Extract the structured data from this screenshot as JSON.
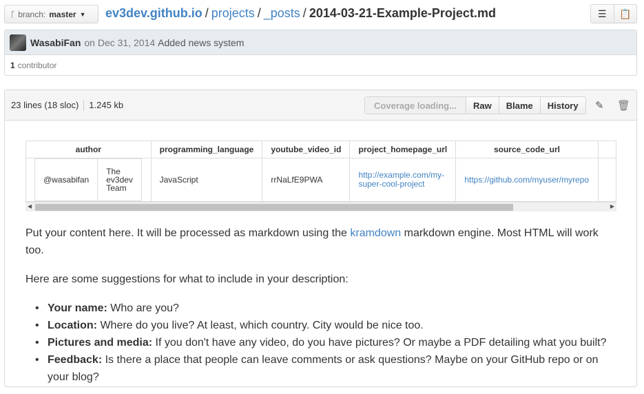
{
  "breadcrumb": {
    "branch_label": "branch:",
    "branch_name": "master",
    "root": "ev3dev.github.io",
    "sep": "/",
    "parts": [
      "projects",
      "_posts"
    ],
    "file": "2014-03-21-Example-Project.md"
  },
  "commit": {
    "author": "WasabiFan",
    "date": "on Dec 31, 2014",
    "message": "Added news system",
    "contributors_count": "1",
    "contributors_label": "contributor"
  },
  "file_header": {
    "lines": "23 lines (18 sloc)",
    "size": "1.245 kb",
    "coverage": "Coverage loading...",
    "raw": "Raw",
    "blame": "Blame",
    "history": "History"
  },
  "table": {
    "headers": [
      "author",
      "programming_language",
      "youtube_video_id",
      "project_homepage_url",
      "source_code_url"
    ],
    "author_cells": [
      "@wasabifan",
      "The ev3dev Team"
    ],
    "programming_language": "JavaScript",
    "youtube_video_id": "rrNaLfE9PWA",
    "project_homepage_url": "http://example.com/my-super-cool-project",
    "project_homepage_url_line1": "http://example.com/my-",
    "project_homepage_url_line2": "super-cool-project",
    "source_code_url": "https://github.com/myuser/myrepo",
    "author_team_line1": "The",
    "author_team_line2": "ev3dev",
    "author_team_line3": "Team"
  },
  "markdown": {
    "p1_before": "Put your content here. It will be processed as markdown using the ",
    "p1_link": "kramdown",
    "p1_after": " markdown engine. Most HTML will work too.",
    "p2": "Here are some suggestions for what to include in your description:",
    "items": [
      {
        "label": "Your name:",
        "text": " Who are you?"
      },
      {
        "label": "Location:",
        "text": " Where do you live? At least, which country. City would be nice too."
      },
      {
        "label": "Pictures and media:",
        "text": " If you don't have any video, do you have pictures? Or maybe a PDF detailing what you built?"
      },
      {
        "label": "Feedback:",
        "text": " Is there a place that people can leave comments or ask questions? Maybe on your GitHub repo or on your blog?"
      }
    ]
  }
}
